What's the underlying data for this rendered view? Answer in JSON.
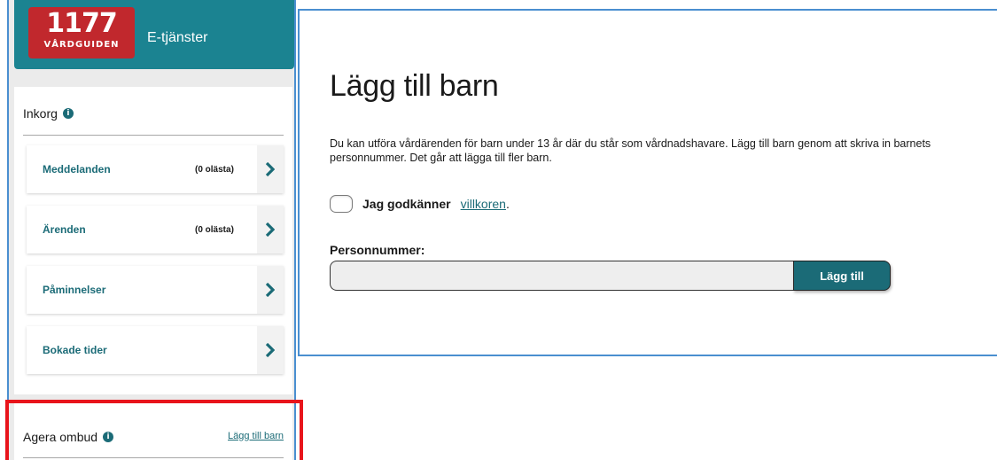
{
  "brand": {
    "logo_number": "1177",
    "logo_subtitle": "VÅRDGUIDEN",
    "service_title": "E-tjänster"
  },
  "inbox": {
    "heading": "Inkorg",
    "info_glyph": "i",
    "items": [
      {
        "label": "Meddelanden",
        "count": "(0 olästa)"
      },
      {
        "label": "Ärenden",
        "count": "(0 olästa)"
      },
      {
        "label": "Påminnelser",
        "count": ""
      },
      {
        "label": "Bokade tider",
        "count": ""
      }
    ]
  },
  "ombud": {
    "heading": "Agera ombud",
    "info_glyph": "i",
    "add_child_link": "Lägg till barn"
  },
  "main": {
    "title": "Lägg till barn",
    "intro": "Du kan utföra vårdärenden för barn under 13 år där du står som vårdnadshavare. Lägg till barn genom att skriva in barnets personnummer. Det går att lägga till fler barn.",
    "consent_label": "Jag godkänner",
    "consent_link": "villkoren",
    "consent_period": ".",
    "pnr_label": "Personnummer:",
    "pnr_value": "",
    "pnr_placeholder": "",
    "add_button": "Lägg till"
  },
  "colors": {
    "brand_teal": "#1b8391",
    "link_teal": "#1b6b77",
    "logo_red": "#c1282d",
    "highlight_red": "#e8141b",
    "frame_blue": "#4a8fd0"
  },
  "icons": {
    "info": "info-icon",
    "chevron": "chevron-right-icon",
    "checkbox": "checkbox-unchecked"
  }
}
